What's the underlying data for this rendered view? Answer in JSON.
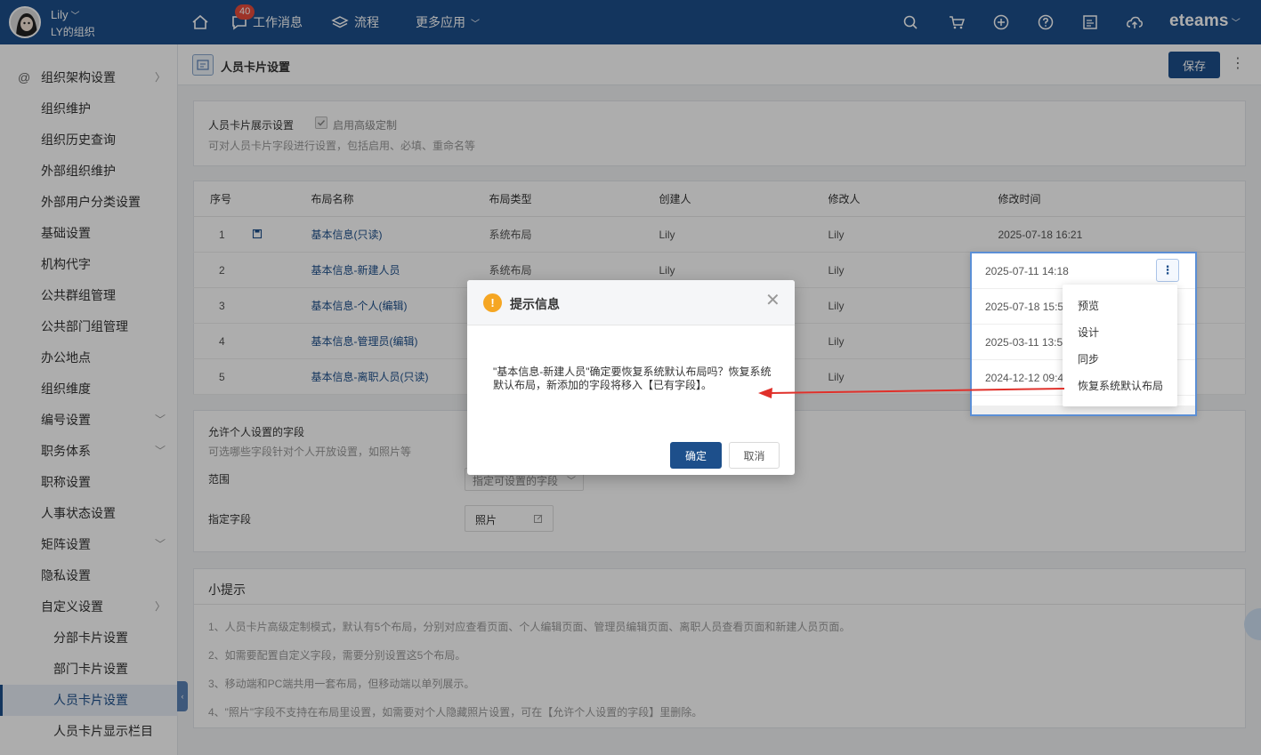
{
  "header": {
    "user_name": "Lily",
    "org_name": "LY的组织",
    "nav": [
      {
        "label": "工作消息",
        "badge": "40"
      },
      {
        "label": "流程"
      },
      {
        "label": "更多应用"
      }
    ],
    "brand": "eteams"
  },
  "sidebar": {
    "items": [
      {
        "label": "组织架构设置"
      },
      {
        "label": "组织维护"
      },
      {
        "label": "组织历史查询"
      },
      {
        "label": "外部组织维护"
      },
      {
        "label": "外部用户分类设置"
      },
      {
        "label": "基础设置"
      },
      {
        "label": "机构代字"
      },
      {
        "label": "公共群组管理"
      },
      {
        "label": "公共部门组管理"
      },
      {
        "label": "办公地点"
      },
      {
        "label": "组织维度"
      },
      {
        "label": "编号设置"
      },
      {
        "label": "职务体系"
      },
      {
        "label": "职称设置"
      },
      {
        "label": "人事状态设置"
      },
      {
        "label": "矩阵设置"
      },
      {
        "label": "隐私设置"
      },
      {
        "label": "自定义设置"
      },
      {
        "label": "分部卡片设置"
      },
      {
        "label": "部门卡片设置"
      },
      {
        "label": "人员卡片设置"
      },
      {
        "label": "人员卡片显示栏目"
      }
    ]
  },
  "page": {
    "title": "人员卡片设置",
    "save_label": "保存"
  },
  "display_settings": {
    "title": "人员卡片展示设置",
    "checkbox_label": "启用高级定制",
    "desc": "可对人员卡片字段进行设置，包括启用、必填、重命名等"
  },
  "table": {
    "headers": [
      "序号",
      "布局名称",
      "布局类型",
      "创建人",
      "修改人",
      "修改时间"
    ],
    "rows": [
      {
        "no": "1",
        "name": "基本信息(只读)",
        "type": "系统布局",
        "creator": "Lily",
        "modifier": "Lily",
        "time": "2025-07-18 16:21"
      },
      {
        "no": "2",
        "name": "基本信息-新建人员",
        "type": "系统布局",
        "creator": "Lily",
        "modifier": "Lily",
        "time": "2025-07-11 14:18"
      },
      {
        "no": "3",
        "name": "基本信息-个人(编辑)",
        "type": "",
        "creator": "",
        "modifier": "Lily",
        "time": "2025-07-18 15:5"
      },
      {
        "no": "4",
        "name": "基本信息-管理员(编辑)",
        "type": "",
        "creator": "",
        "modifier": "Lily",
        "time": "2025-03-11 13:5"
      },
      {
        "no": "5",
        "name": "基本信息-离职人员(只读)",
        "type": "",
        "creator": "",
        "modifier": "Lily",
        "time": "2024-12-12 09:4"
      }
    ]
  },
  "personal_fields": {
    "title": "允许个人设置的字段",
    "desc": "可选哪些字段针对个人开放设置，如照片等",
    "scope_label": "范围",
    "scope_value": "指定可设置的字段",
    "field_label": "指定字段",
    "field_value": "照片"
  },
  "tips": {
    "title": "小提示",
    "items": [
      "1、人员卡片高级定制模式，默认有5个布局，分别对应查看页面、个人编辑页面、管理员编辑页面、离职人员查看页面和新建人员页面。",
      "2、如需要配置自定义字段，需要分别设置这5个布局。",
      "3、移动端和PC端共用一套布局，但移动端以单列展示。",
      "4、\"照片\"字段不支持在布局里设置，如需要对个人隐藏照片设置，可在【允许个人设置的字段】里删除。"
    ]
  },
  "context_menu": {
    "items": [
      "预览",
      "设计",
      "同步",
      "恢复系统默认布局"
    ]
  },
  "dialog": {
    "title": "提示信息",
    "message": "\"基本信息-新建人员\"确定要恢复系统默认布局吗？恢复系统默认布局，新添加的字段将移入【已有字段】。",
    "ok_label": "确定",
    "cancel_label": "取消"
  },
  "colors": {
    "primary": "#1d4f8b",
    "warning": "#f5a623",
    "annotation_arrow": "#e0302a"
  }
}
